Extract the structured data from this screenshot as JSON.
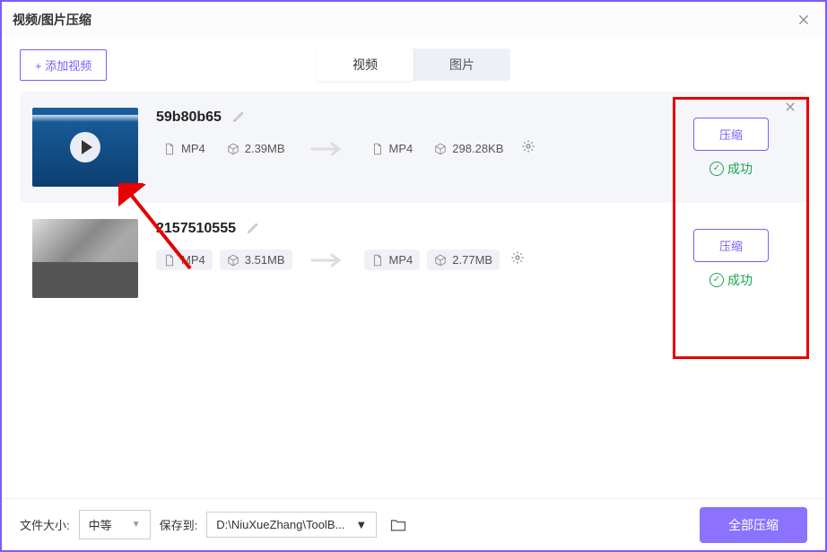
{
  "titlebar": {
    "title": "视频/图片压缩"
  },
  "toolbar": {
    "add_label": "+ 添加视频"
  },
  "tabs": {
    "video": "视频",
    "image": "图片"
  },
  "items": [
    {
      "name": "59b80b65",
      "src_format": "MP4",
      "src_size": "2.39MB",
      "dst_format": "MP4",
      "dst_size": "298.28KB",
      "action_label": "压缩",
      "status": "成功"
    },
    {
      "name": "2157510555",
      "src_format": "MP4",
      "src_size": "3.51MB",
      "dst_format": "MP4",
      "dst_size": "2.77MB",
      "action_label": "压缩",
      "status": "成功"
    }
  ],
  "footer": {
    "size_label": "文件大小:",
    "size_value": "中等",
    "save_label": "保存到:",
    "save_path": "D:\\NiuXueZhang\\ToolB...",
    "all_label": "全部压缩"
  }
}
